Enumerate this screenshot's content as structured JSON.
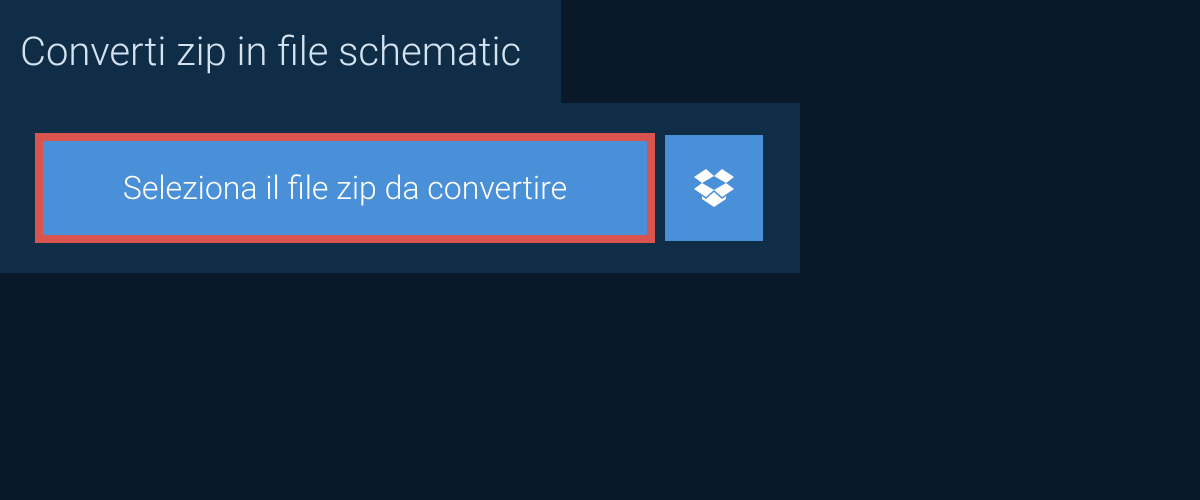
{
  "header": {
    "title": "Converti zip in file schematic"
  },
  "upload": {
    "select_label": "Seleziona il file zip da convertire",
    "dropbox_icon": "dropbox"
  }
}
